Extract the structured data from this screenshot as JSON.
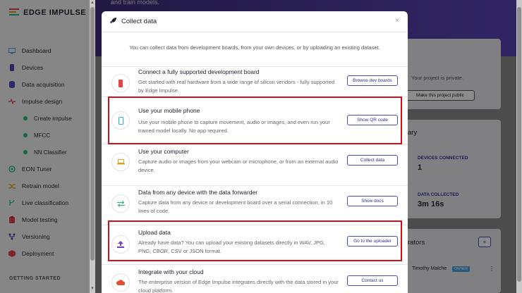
{
  "brand": {
    "name": "EDGE IMPULSE"
  },
  "sidebar": {
    "items": [
      {
        "label": "Dashboard",
        "icon": "monitor-icon",
        "color": "#4aa3df"
      },
      {
        "label": "Devices",
        "icon": "device-icon",
        "color": "#4a4ab8"
      },
      {
        "label": "Data acquisition",
        "icon": "database-icon",
        "color": "#4a4ab8"
      },
      {
        "label": "Impulse design",
        "icon": "pulse-icon",
        "color": "#e04848"
      },
      {
        "label": "Create impulse",
        "sub": true
      },
      {
        "label": "MFCC",
        "sub": true
      },
      {
        "label": "NN Classifier",
        "sub": true
      },
      {
        "label": "EON Tuner",
        "icon": "target-icon",
        "color": "#2bb673"
      },
      {
        "label": "Retrain model",
        "icon": "shuffle-icon",
        "color": "#e0a020"
      },
      {
        "label": "Live classification",
        "icon": "branch-icon",
        "color": "#2bb673"
      },
      {
        "label": "Model testing",
        "icon": "clipboard-icon",
        "color": "#e04848"
      },
      {
        "label": "Versioning",
        "icon": "fork-icon",
        "color": "#4a4ab8"
      },
      {
        "label": "Deployment",
        "icon": "box-icon",
        "color": "#e04848"
      }
    ],
    "getting_started": "GETTING STARTED"
  },
  "background": {
    "banner_text": "and train models.",
    "privacy_text": "Your project is private.",
    "make_public": "Make this project public",
    "summary_title": "ary",
    "devices_label": "DEVICES CONNECTED",
    "devices_value": "1",
    "data_label": "DATA COLLECTED",
    "data_value": "3m 16s",
    "collab_title": "rators",
    "collab_name": "Timothy Malche",
    "collab_badge": "OWNER"
  },
  "modal": {
    "title": "Collect data",
    "intro": "You can collect data from development boards, from your own devices, or by uploading an existing dataset.",
    "options": [
      {
        "title": "Connect a fully supported development board",
        "desc": "Get started with real hardware from a wide range of silicon vendors - fully supported by Edge Impulse.",
        "button": "Browse dev boards",
        "icon": "devboard-icon",
        "icon_color": "#e04848"
      },
      {
        "title": "Use your mobile phone",
        "desc": "Use your mobile phone to capture movement, audio or images, and even run your trained model locally. No app required.",
        "button": "Show QR code",
        "icon": "phone-icon",
        "icon_color": "#2ab0d8"
      },
      {
        "title": "Use your computer",
        "desc": "Capture audio or images from your webcam or microphone, or from an external audio device.",
        "button": "Collect data",
        "icon": "laptop-icon",
        "icon_color": "#e0a020"
      },
      {
        "title": "Data from any device with the data forwarder",
        "desc": "Capture data from any device or development board over a serial connection, in 10 lines of code.",
        "button": "Show docs",
        "icon": "forward-icon",
        "icon_color": "#2bb673"
      },
      {
        "title": "Upload data",
        "desc": "Already have data? You can upload your existing datasets directly in WAV, JPG, PNG, CBOR, CSV or JSON format.",
        "button": "Go to the uploader",
        "icon": "upload-icon",
        "icon_color": "#7a3fb8"
      },
      {
        "title": "Integrate with your cloud",
        "desc": "The enterprise version of Edge Impulse integrates directly with the data stored in your cloud platform.",
        "button": "Contact us",
        "icon": "cloud-icon",
        "icon_color": "#e05030"
      }
    ]
  },
  "highlight_color": "#d0111a"
}
